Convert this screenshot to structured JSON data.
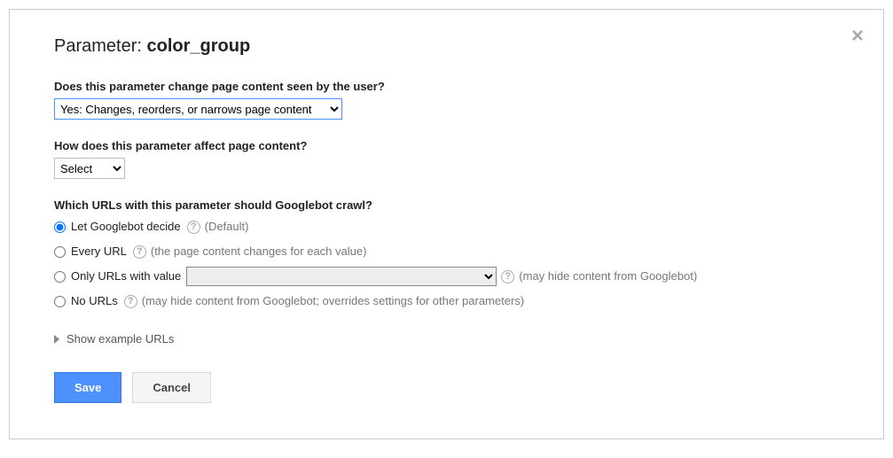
{
  "title": {
    "prefix": "Parameter: ",
    "name": "color_group"
  },
  "q1": {
    "label": "Does this parameter change page content seen by the user?",
    "selected": "Yes: Changes, reorders, or narrows page content"
  },
  "q2": {
    "label": "How does this parameter affect page content?",
    "selected": "Select"
  },
  "q3": {
    "label": "Which URLs with this parameter should Googlebot crawl?",
    "options": {
      "decide": {
        "label": "Let Googlebot decide",
        "hint": "(Default)"
      },
      "every": {
        "label": "Every URL",
        "hint": "(the page content changes for each value)"
      },
      "only": {
        "label": "Only URLs with value",
        "hint": "(may hide content from Googlebot)"
      },
      "none": {
        "label": "No URLs",
        "hint": "(may hide content from Googlebot; overrides settings for other parameters)"
      }
    }
  },
  "help_glyph": "?",
  "expand_label": "Show example URLs",
  "buttons": {
    "save": "Save",
    "cancel": "Cancel"
  },
  "close_glyph": "×"
}
